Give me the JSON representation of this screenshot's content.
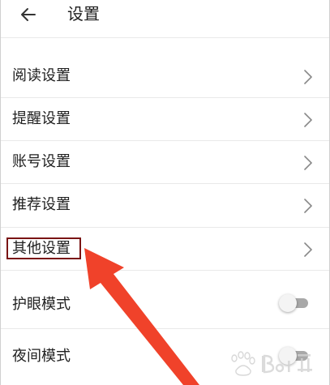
{
  "header": {
    "back_icon": "arrow-left-icon",
    "title": "设置"
  },
  "menu_items": [
    {
      "label": "阅读设置",
      "icon": "chevron-right-icon"
    },
    {
      "label": "提醒设置",
      "icon": "chevron-right-icon"
    },
    {
      "label": "账号设置",
      "icon": "chevron-right-icon"
    },
    {
      "label": "推荐设置",
      "icon": "chevron-right-icon"
    },
    {
      "label": "其他设置",
      "icon": "chevron-right-icon",
      "highlighted": true
    }
  ],
  "toggles": [
    {
      "label": "护眼模式",
      "on": false
    },
    {
      "label": "夜间模式",
      "on": false
    }
  ],
  "annotation": {
    "highlight_color": "#7a1414",
    "arrow_color": "#f0422a"
  },
  "watermark": {
    "text": "Bai经验",
    "kind": "logo"
  }
}
